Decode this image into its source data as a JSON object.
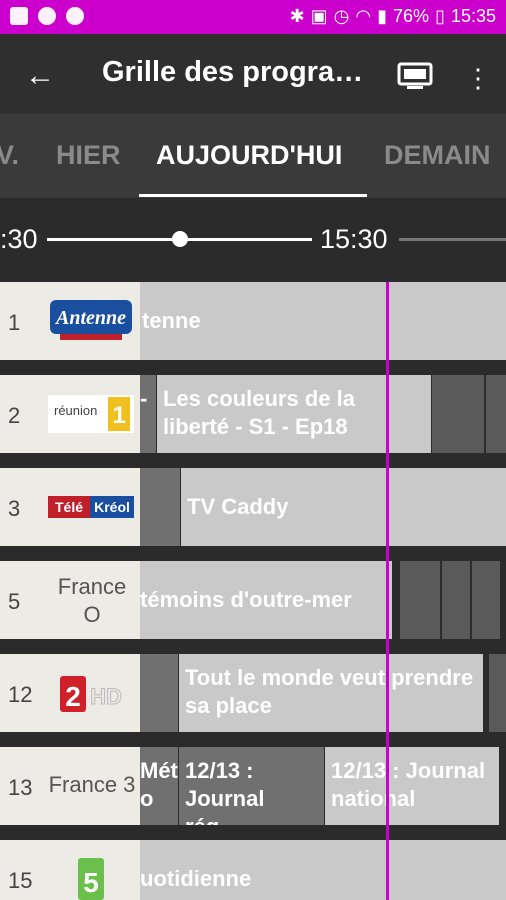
{
  "status_bar": {
    "battery": "76%",
    "time": "15:35",
    "icons": [
      "image-icon",
      "smiley-icon",
      "target-icon",
      "bluetooth-icon",
      "nfc-icon",
      "alarm-icon",
      "wifi-icon",
      "signal-icon",
      "battery-icon"
    ]
  },
  "toolbar": {
    "title": "Grille des progra…"
  },
  "tabs": [
    {
      "label": "V."
    },
    {
      "label": "HIER"
    },
    {
      "label": "AUJOURD'HUI",
      "active": true
    },
    {
      "label": "DEMAIN"
    }
  ],
  "timeline": {
    "left_time": ":30",
    "right_time": "15:30"
  },
  "channels": [
    {
      "number": "1",
      "name": "Antenne Réunion",
      "programs": [
        {
          "title": "tenne"
        }
      ]
    },
    {
      "number": "2",
      "name": "Réunion 1ère",
      "programs": [
        {
          "title": "-"
        },
        {
          "title": "Les couleurs de la liberté - S1 - Ep18"
        }
      ]
    },
    {
      "number": "3",
      "name": "Télé Kréol",
      "programs": [
        {
          "title": "TV Caddy"
        }
      ]
    },
    {
      "number": "5",
      "name": "France O",
      "name_lines": [
        "France",
        "O"
      ],
      "programs": [
        {
          "title": "témoins d'outre-mer"
        }
      ]
    },
    {
      "number": "12",
      "name": "France 2 HD",
      "programs": [
        {
          "title": "Tout le monde veut prendre sa place"
        }
      ]
    },
    {
      "number": "13",
      "name": "France 3",
      "programs": [
        {
          "title": "Mét o"
        },
        {
          "title": "12/13 : Journal rég…"
        },
        {
          "title": "12/13 : Journal national"
        }
      ]
    },
    {
      "number": "15",
      "name": "France 5",
      "programs": [
        {
          "title": "uotidienne"
        }
      ]
    }
  ],
  "colors": {
    "accent": "#cc00cc",
    "toolbar": "#2f2f2f",
    "tabs": "#3a3a3a",
    "program": "#c9c9c9",
    "program_dark": "#707070"
  }
}
